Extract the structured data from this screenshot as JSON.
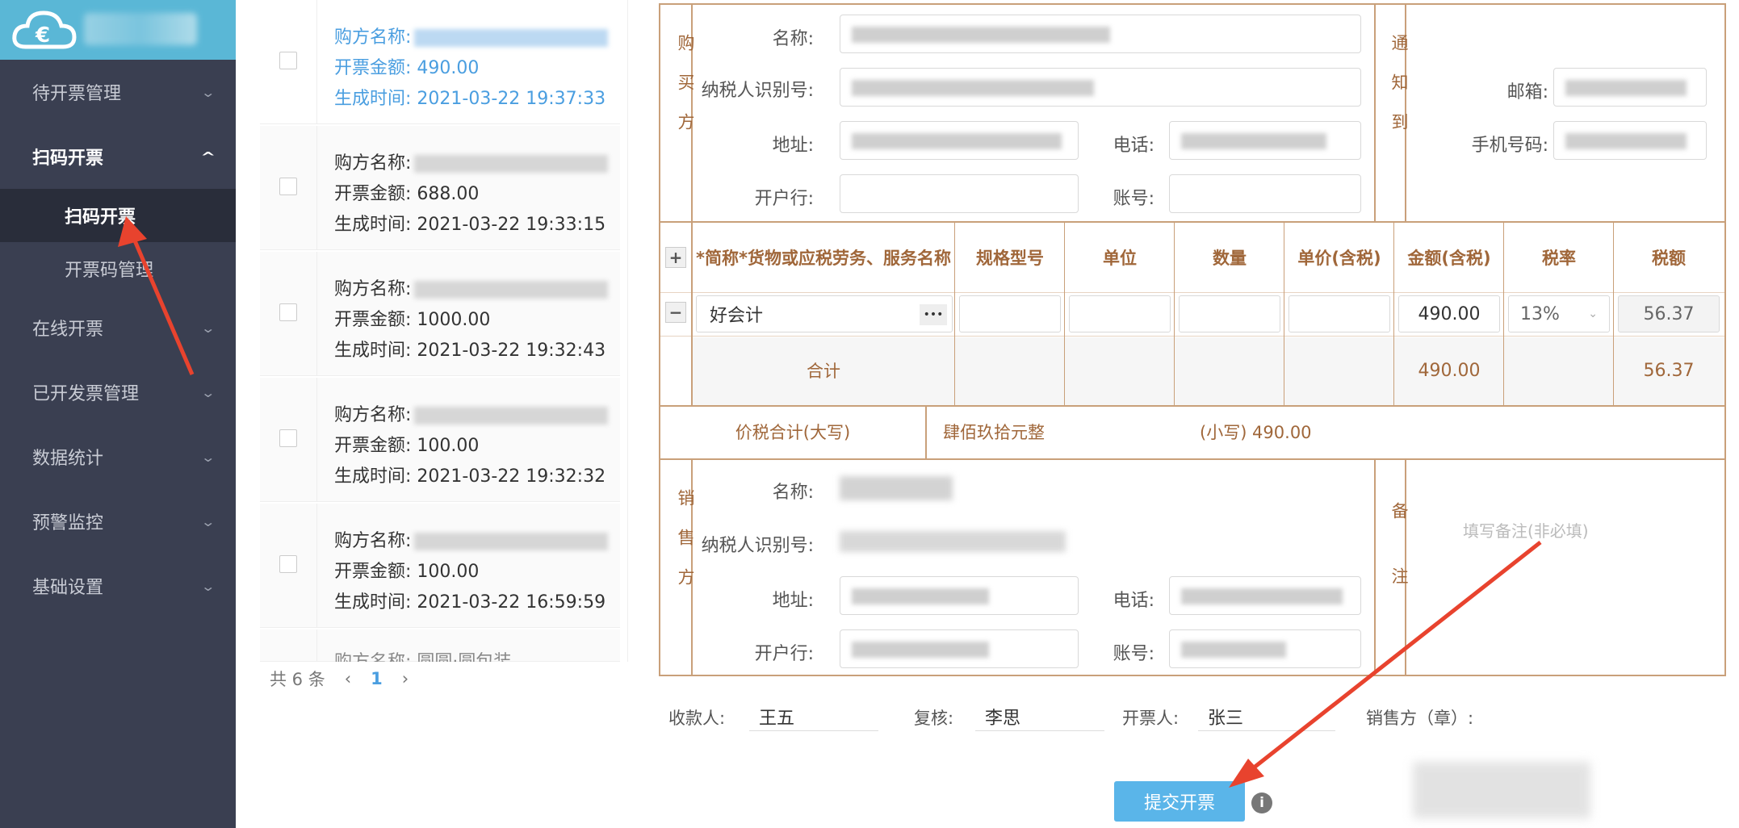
{
  "sidebar": {
    "items": [
      {
        "label": "待开票管理"
      },
      {
        "label": "扫码开票"
      },
      {
        "label": "在线开票"
      },
      {
        "label": "已开发票管理"
      },
      {
        "label": "数据统计"
      },
      {
        "label": "预警监控"
      },
      {
        "label": "基础设置"
      }
    ],
    "subitems": [
      {
        "label": "扫码开票"
      },
      {
        "label": "开票码管理"
      }
    ]
  },
  "list": {
    "buyer_label": "购方名称:",
    "amount_label": "开票金额:",
    "time_label": "生成时间:",
    "cards": [
      {
        "amount": "490.00",
        "time": "2021-03-22 19:37:33"
      },
      {
        "amount": "688.00",
        "time": "2021-03-22 19:33:15"
      },
      {
        "amount": "1000.00",
        "time": "2021-03-22 19:32:43"
      },
      {
        "amount": "100.00",
        "time": "2021-03-22 19:32:32"
      },
      {
        "amount": "100.00",
        "time": "2021-03-22 16:59:59"
      }
    ],
    "partial_card_text": "购方名称: 圆圆·圆包装"
  },
  "pager": {
    "total": "共 6 条",
    "prev": "‹",
    "current": "1",
    "next": "›"
  },
  "invoice": {
    "buyer_section": "购买方",
    "notify_section": "通知到",
    "seller_section": "销售方",
    "remark_section": "备注",
    "name_label": "名称:",
    "tax_id_label": "纳税人识别号:",
    "address_label": "地址:",
    "phone_label": "电话:",
    "bank_label": "开户行:",
    "account_label": "账号:",
    "email_label": "邮箱:",
    "mobile_label": "手机号码:",
    "columns": [
      "*简称*货物或应税劳务、服务名称",
      "规格型号",
      "单位",
      "数量",
      "单价(含税)",
      "金额(含税)",
      "税率",
      "税额"
    ],
    "add_row": "+",
    "remove_row": "−",
    "item": {
      "name": "好会计",
      "more": "•••",
      "amount": "490.00",
      "tax_rate": "13%",
      "tax": "56.37"
    },
    "total_label": "合计",
    "total_amount": "490.00",
    "total_tax": "56.37",
    "grand_total_label": "价税合计(大写)",
    "grand_total_upper": "肆佰玖拾元整",
    "grand_total_lower": "(小写) 490.00",
    "remark_placeholder": "填写备注(非必填)"
  },
  "footer": {
    "payee_label": "收款人:",
    "payee": "王五",
    "reviewer_label": "复核:",
    "reviewer": "李思",
    "issuer_label": "开票人:",
    "issuer": "张三",
    "seller_seal_label": "销售方（章）:",
    "submit_label": "提交开票",
    "info_icon": "i"
  },
  "colors": {
    "sidebar": "#3a3f51",
    "logo_bar": "#5ab7d6",
    "accent": "#4a9ee0",
    "invoice_border": "#c9a07a",
    "invoice_text": "#a0673a",
    "submit": "#5ab5e9",
    "arrow": "#e8432e"
  }
}
